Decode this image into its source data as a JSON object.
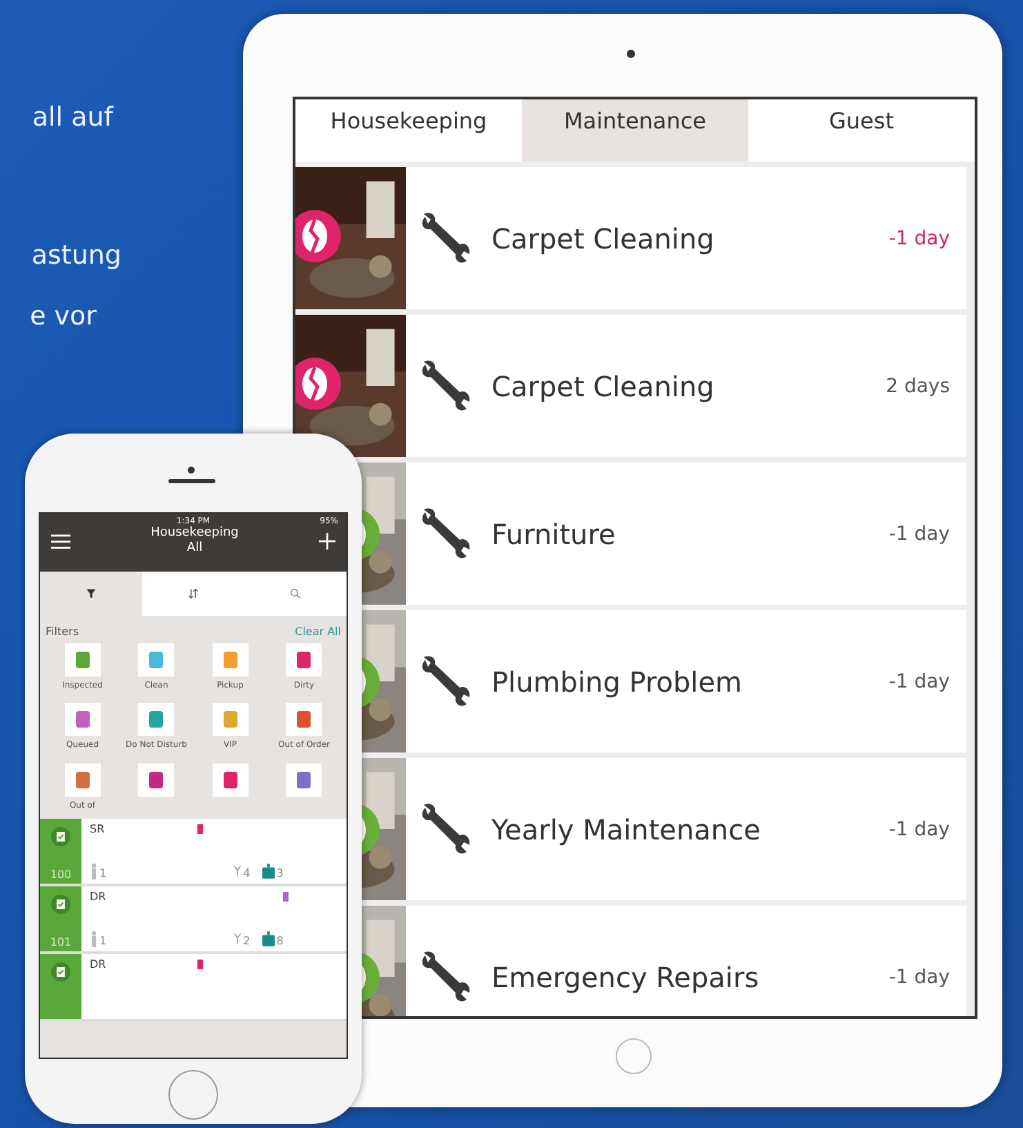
{
  "side_text": [
    "all auf",
    "astung",
    "e vor"
  ],
  "tablet": {
    "tabs": [
      {
        "label": "Housekeeping",
        "selected": false
      },
      {
        "label": "Maintenance",
        "selected": true
      },
      {
        "label": "Guest",
        "selected": false
      }
    ],
    "tasks": [
      {
        "title": "Carpet Cleaning",
        "due": "-1 day",
        "overdue": true,
        "color": "#e0246a"
      },
      {
        "title": "Carpet Cleaning",
        "due": "2 days",
        "overdue": false,
        "color": "#e0246a"
      },
      {
        "title": "Furniture",
        "due": "-1 day",
        "overdue": false,
        "color": "#6aae3a"
      },
      {
        "title": "Plumbing Problem",
        "due": "-1 day",
        "overdue": false,
        "color": "#6aae3a"
      },
      {
        "title": "Yearly Maintenance",
        "due": "-1 day",
        "overdue": false,
        "color": "#6aae3a"
      },
      {
        "title": "Emergency Repairs",
        "due": "-1 day",
        "overdue": false,
        "color": "#6aae3a"
      }
    ]
  },
  "phone": {
    "status_time": "1:34 PM",
    "battery": "95%",
    "title": "Housekeeping",
    "subtitle": "All",
    "tabs": [
      {
        "kind": "filter",
        "selected": true
      },
      {
        "kind": "sort",
        "selected": false
      },
      {
        "kind": "search",
        "selected": false
      }
    ],
    "filters_label": "Filters",
    "clear_label": "Clear All",
    "filters": [
      {
        "label": "Inspected",
        "color": "#5aa83a"
      },
      {
        "label": "Clean",
        "color": "#4ab8d8"
      },
      {
        "label": "Pickup",
        "color": "#f0a030"
      },
      {
        "label": "Dirty",
        "color": "#e0246a"
      },
      {
        "label": "Queued",
        "color": "#c060c0"
      },
      {
        "label": "Do Not Disturb",
        "color": "#20a8a0"
      },
      {
        "label": "VIP",
        "color": "#e0a830"
      },
      {
        "label": "Out of Order",
        "color": "#e05030"
      },
      {
        "label": "Out of",
        "color": "#d07040"
      },
      {
        "color": "#c02a80"
      },
      {
        "color": "#e0246a"
      },
      {
        "color": "#7a70c8"
      }
    ],
    "rooms": [
      {
        "number": "100",
        "type": "SR",
        "guests": "1",
        "tools": "4",
        "bags": "3",
        "color": "#e0246a"
      },
      {
        "number": "101",
        "type": "DR",
        "guests": "1",
        "tools": "2",
        "bags": "8",
        "color": "#b060d0"
      },
      {
        "type": "DR",
        "color": "#e0246a"
      }
    ]
  }
}
